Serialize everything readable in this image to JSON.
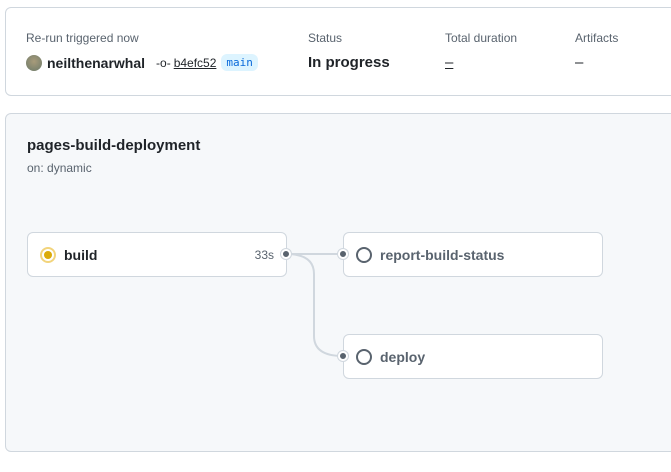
{
  "summary": {
    "trigger_label": "Re-run triggered now",
    "user": "neilthenarwhal",
    "commit_sha": "b4efc52",
    "branch": "main",
    "status_label": "Status",
    "status_value": "In progress",
    "duration_label": "Total duration",
    "duration_value": "–",
    "artifacts_label": "Artifacts",
    "artifacts_value": "–"
  },
  "workflow": {
    "title": "pages-build-deployment",
    "trigger": "on: dynamic",
    "jobs": [
      {
        "name": "build",
        "duration": "33s",
        "status": "in_progress"
      },
      {
        "name": "report-build-status",
        "status": "pending"
      },
      {
        "name": "deploy",
        "status": "pending"
      }
    ]
  },
  "colors": {
    "in_progress": "#dbab0a",
    "pending": "#59636e",
    "link": "#0969da"
  }
}
